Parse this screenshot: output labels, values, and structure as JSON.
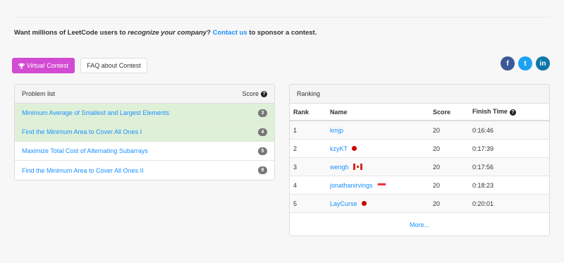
{
  "sponsor": {
    "prefix": "Want millions of LeetCode users to ",
    "emphasis": "recognize your company",
    "middle": "? ",
    "link": "Contact us",
    "suffix": " to sponsor a contest."
  },
  "buttons": {
    "virtual_prefix": "Virtual",
    "virtual_suffix": "Contest",
    "faq": "FAQ about Contest"
  },
  "social": {
    "facebook": "f",
    "twitter": "t",
    "linkedin": "in"
  },
  "problem_list": {
    "header": "Problem list",
    "score_header": "Score",
    "items": [
      {
        "title": "Minimum Average of Smallest and Largest Elements",
        "score": "3",
        "solved": true
      },
      {
        "title": "Find the Minimum Area to Cover All Ones I",
        "score": "4",
        "solved": true
      },
      {
        "title": "Maximize Total Cost of Alternating Subarrays",
        "score": "5",
        "solved": false
      },
      {
        "title": "Find the Minimum Area to Cover All Ones II",
        "score": "8",
        "solved": false
      }
    ]
  },
  "ranking": {
    "header": "Ranking",
    "columns": {
      "rank": "Rank",
      "name": "Name",
      "score": "Score",
      "finish_time": "Finish Time"
    },
    "rows": [
      {
        "rank": "1",
        "name": "kmjp",
        "flag": "none",
        "score": "20",
        "time": "0:16:46"
      },
      {
        "rank": "2",
        "name": "kzyKT",
        "flag": "japan",
        "score": "20",
        "time": "0:17:39"
      },
      {
        "rank": "3",
        "name": "wengh",
        "flag": "canada",
        "score": "20",
        "time": "0:17:56"
      },
      {
        "rank": "4",
        "name": "jonathanirvings",
        "flag": "singapore",
        "score": "20",
        "time": "0:18:23"
      },
      {
        "rank": "5",
        "name": "LayCurse",
        "flag": "japan",
        "score": "20",
        "time": "0:20:01"
      }
    ],
    "more": "More..."
  },
  "colors": {
    "accent_link": "#1a90ff",
    "virtual_button": "#d34ad3",
    "solved_row": "#dff0d8",
    "facebook": "#3b5998",
    "twitter": "#1da1f2",
    "linkedin": "#0e76a8"
  },
  "icons": {
    "virtual_button": "trophy-icon",
    "help": "question-circle-icon"
  }
}
